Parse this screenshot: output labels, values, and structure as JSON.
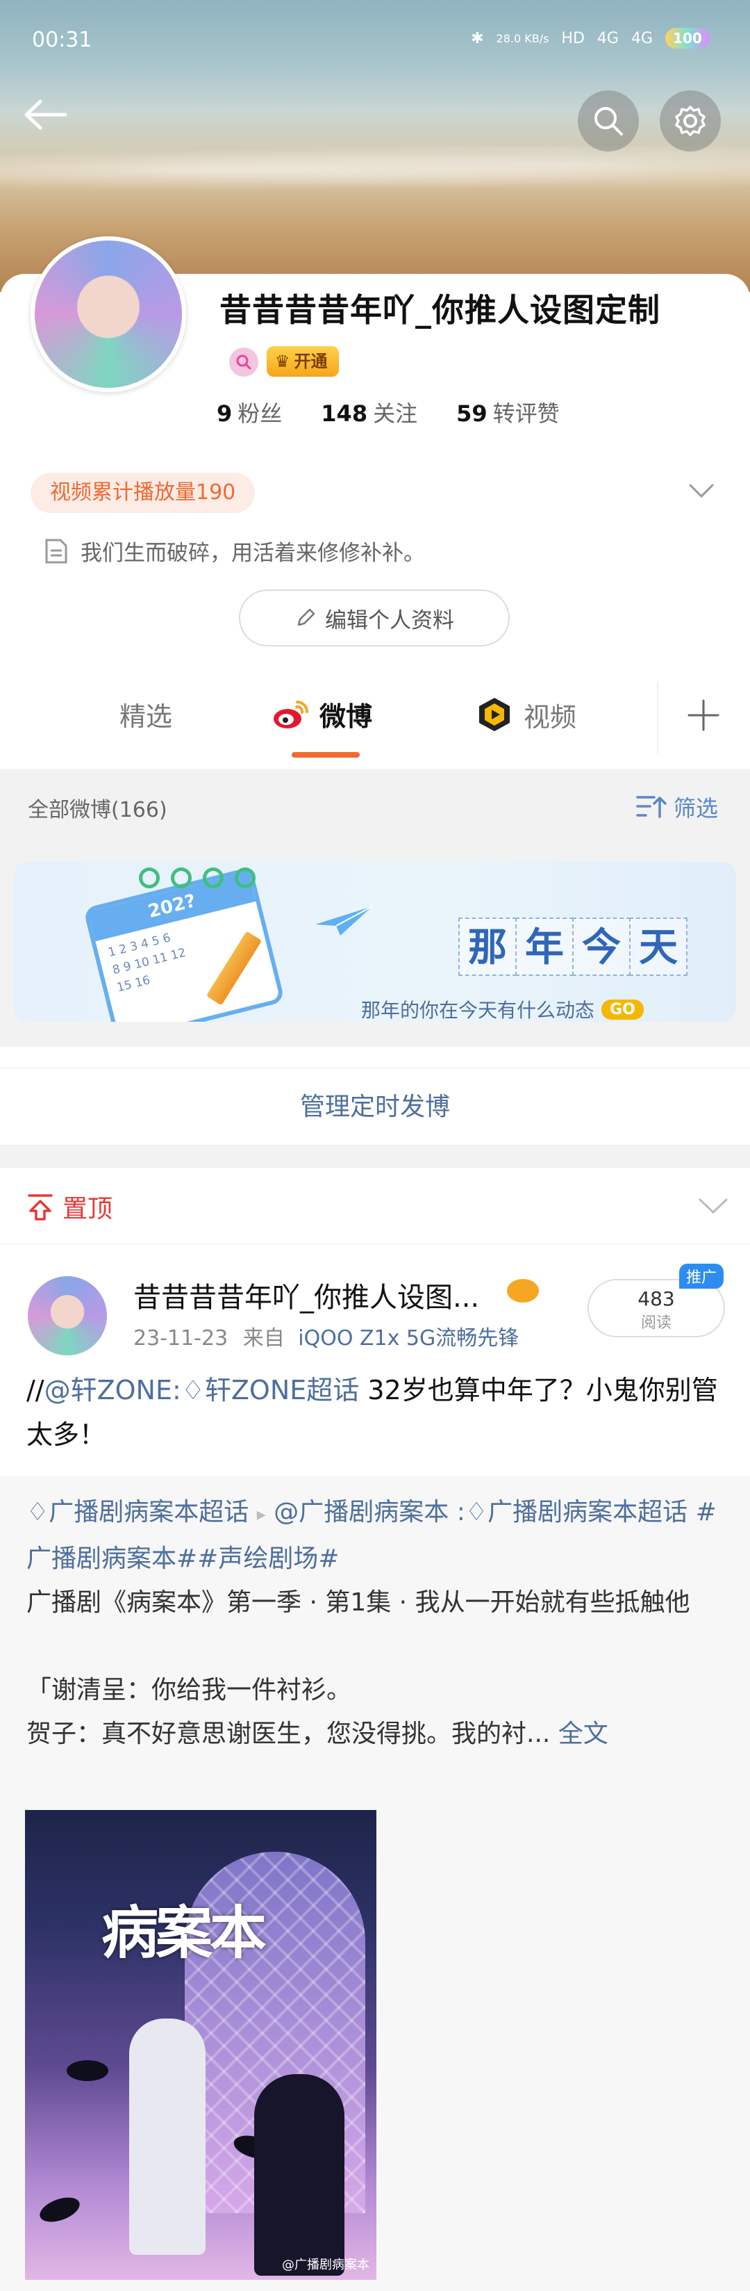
{
  "status_bar": {
    "time": "00:31",
    "net_speed": "28.0 KB/s",
    "hd_label": "HD",
    "signal_1": "4G",
    "signal_2": "4G",
    "battery": "100"
  },
  "profile": {
    "username": "昔昔昔昔年吖_你推人设图定制",
    "vip_label": "开通",
    "stats": [
      {
        "num": "9",
        "label": "粉丝"
      },
      {
        "num": "148",
        "label": "关注"
      },
      {
        "num": "59",
        "label": "转评赞"
      }
    ],
    "play_count": "视频累计播放量190",
    "bio": "我们生而破碎，用活着来修修补补。",
    "edit_label": "编辑个人资料"
  },
  "tabs": [
    {
      "label": "精选"
    },
    {
      "label": "微博"
    },
    {
      "label": "视频"
    }
  ],
  "filter": {
    "all_label": "全部微博(166)",
    "filter_label": "筛选"
  },
  "memory_banner": {
    "year": "202?",
    "calendar_numbers": "1 2 3 4 5 6\n8 9 10 11 12\n15 16",
    "title_chars": [
      "那",
      "年",
      "今",
      "天"
    ],
    "subtitle": "那年的你在今天有什么动态",
    "go_label": "GO"
  },
  "manage_label": "管理定时发博",
  "pinned_label": "置顶",
  "post": {
    "author": "昔昔昔昔年吖_你推人设图...",
    "date": "23-11-23",
    "source_prefix": "来自",
    "source": "iQOO Z1x 5G流畅先锋",
    "read_count": "483",
    "read_label": "阅读",
    "promo_label": "推广",
    "text_prefix": "//",
    "mention": "@轩ZONE",
    "colon": ":",
    "topic": "轩ZONE超话",
    "body": " 32岁也算中年了？小鬼你别管太多！"
  },
  "repost": {
    "topic_1": "广播剧病案本超话",
    "mention": "@广播剧病案本",
    "colon": " :",
    "topic_2": "广播剧病案本超话",
    "tag_1": " #广播剧病案本#",
    "tag_2": "#声绘剧场#",
    "line_1": "广播剧《病案本》第一季 · 第1集 · 我从一开始就有些抵触他",
    "line_2": "「谢清呈：你给我一件衬衫。",
    "line_3": "贺子：真不好意思谢医生，您没得挑。我的衬...",
    "full_text": "全文",
    "poster_title": "病案本",
    "poster_watermark": "@广播剧病案本"
  }
}
